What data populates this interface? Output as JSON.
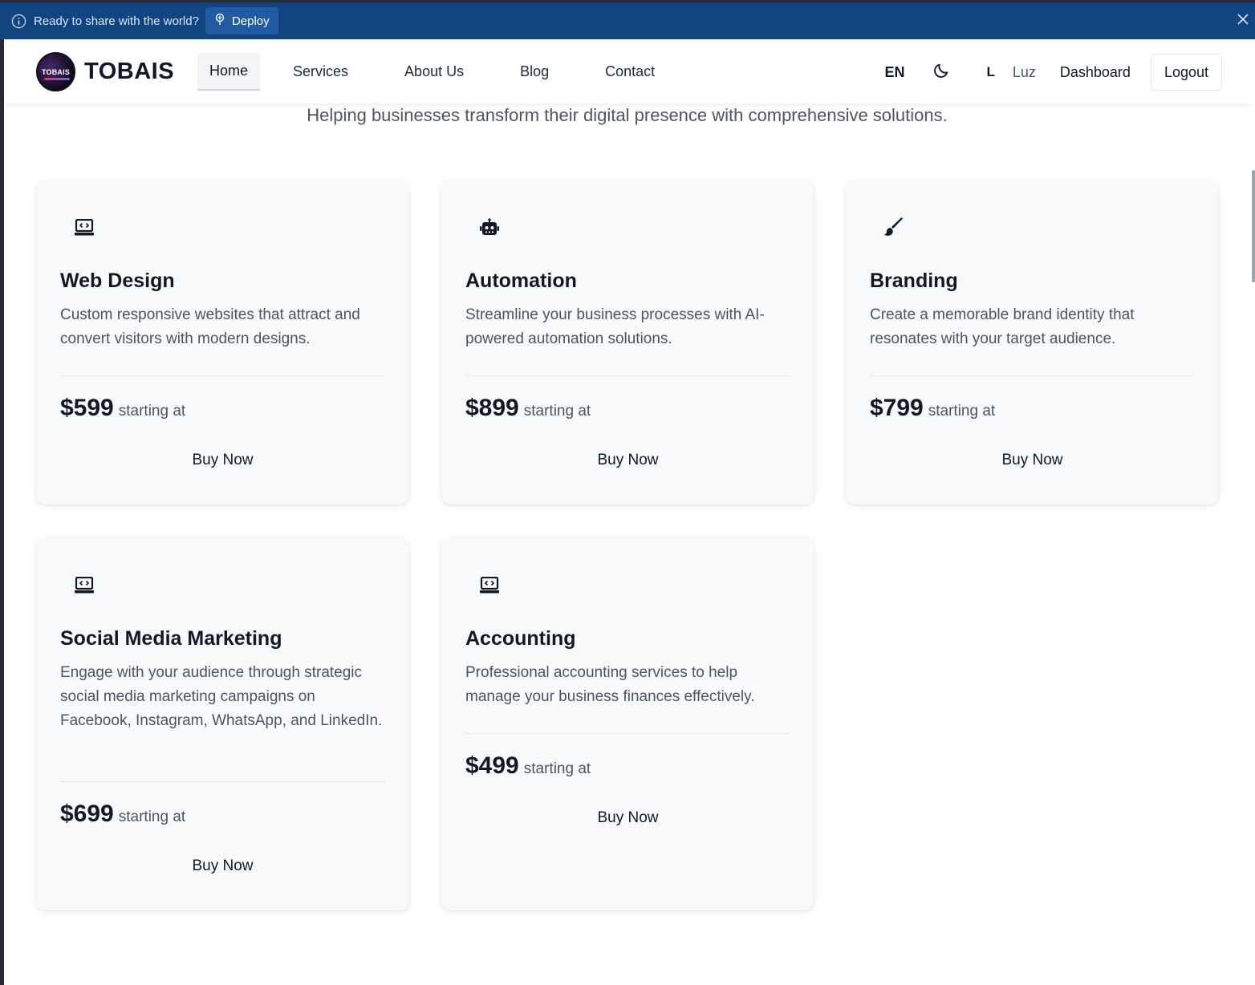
{
  "banner": {
    "message": "Ready to share with the world?",
    "deploy_label": "Deploy"
  },
  "navbar": {
    "logo_text": "TOBAIS",
    "brand": "TOBAIS",
    "links": [
      "Home",
      "Services",
      "About Us",
      "Blog",
      "Contact"
    ],
    "active_link": "Home",
    "language": "EN",
    "user_initial": "L",
    "username": "Luz",
    "dashboard_label": "Dashboard",
    "logout_label": "Logout"
  },
  "subtitle": "Helping businesses transform their digital presence with comprehensive solutions.",
  "services": [
    {
      "icon": "laptop-code-icon",
      "title": "Web Design",
      "description": "Custom responsive websites that attract and convert visitors with modern designs.",
      "price": "$599",
      "price_note": "starting at",
      "buy_label": "Buy Now"
    },
    {
      "icon": "robot-icon",
      "title": "Automation",
      "description": "Streamline your business processes with AI-powered automation solutions.",
      "price": "$899",
      "price_note": "starting at",
      "buy_label": "Buy Now"
    },
    {
      "icon": "paintbrush-icon",
      "title": "Branding",
      "description": "Create a memorable brand identity that resonates with your target audience.",
      "price": "$799",
      "price_note": "starting at",
      "buy_label": "Buy Now"
    },
    {
      "icon": "laptop-code-icon",
      "title": "Social Media Marketing",
      "description": "Engage with your audience through strategic social media marketing campaigns on Facebook, Instagram, WhatsApp, and LinkedIn.",
      "price": "$699",
      "price_note": "starting at",
      "buy_label": "Buy Now"
    },
    {
      "icon": "laptop-code-icon",
      "title": "Accounting",
      "description": "Professional accounting services to help manage your business finances effectively.",
      "price": "$499",
      "price_note": "starting at",
      "buy_label": "Buy Now"
    }
  ],
  "colors": {
    "banner_bg": "#134482",
    "deploy_bg": "#1f5aa3",
    "card_bg": "#f8f9fa",
    "text_primary": "#111827",
    "text_secondary": "#4b5563"
  }
}
